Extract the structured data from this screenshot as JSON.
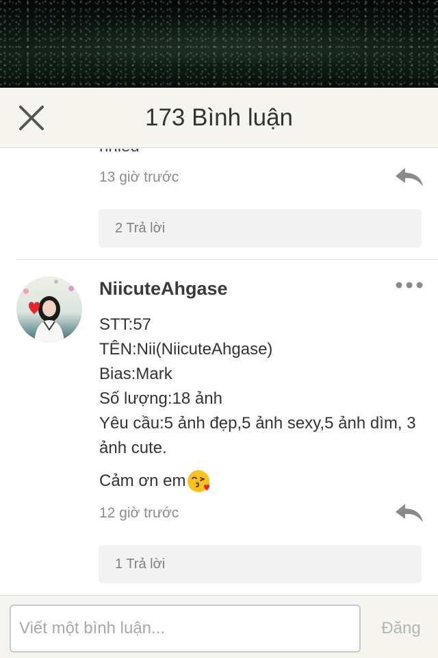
{
  "header": {
    "title": "173 Bình luận",
    "close_icon": "close-icon"
  },
  "previous_comment": {
    "cut_text": "nhiều",
    "time": "13 giờ trước",
    "reply_icon": "reply-arrow-icon",
    "replies_label": "2 Trả lời"
  },
  "comment": {
    "username": "NiicuteAhgase",
    "more_icon": "more-dots-icon",
    "lines": [
      "STT:57",
      "TÊN:Nii(NiicuteAhgase)",
      "Bias:Mark",
      "Số lượng:18 ảnh",
      "Yêu cầu:5 ảnh đẹp,5 ảnh sexy,5 ảnh dìm, 3 ảnh cute."
    ],
    "thanks": "Cảm ơn em",
    "emoji_icon": "face-blowing-kiss-icon",
    "time": "12 giờ trước",
    "reply_icon": "reply-arrow-icon",
    "replies_label": "1 Trả lời"
  },
  "composer": {
    "placeholder": "Viết một bình luận...",
    "value": "",
    "post_label": "Đăng"
  },
  "colors": {
    "header_bg": "#f6f4ef",
    "timestamp": "#8c8c8c",
    "reply_box_bg": "#f2f2f2",
    "post_disabled": "#b4b4b4"
  }
}
